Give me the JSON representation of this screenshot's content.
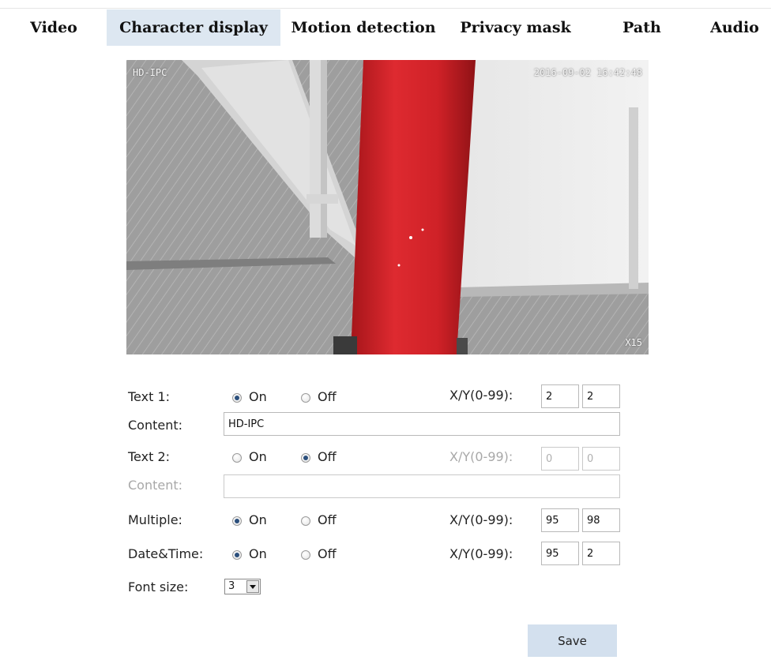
{
  "tabs": {
    "video": "Video",
    "character_display": "Character display",
    "motion_detection": "Motion detection",
    "privacy_mask": "Privacy mask",
    "path": "Path",
    "audio": "Audio"
  },
  "preview": {
    "osd_text1": "HD-IPC",
    "osd_datetime": "2016-09-02 16:42:48",
    "osd_multiple": "X15"
  },
  "form": {
    "text1_label": "Text 1:",
    "text2_label": "Text 2:",
    "content_label": "Content:",
    "multiple_label": "Multiple:",
    "datetime_label": "Date&Time:",
    "font_size_label": "Font size:",
    "on_label": "On",
    "off_label": "Off",
    "xy_label": "X/Y(0-99):",
    "text1": {
      "state": "On",
      "content": "HD-IPC",
      "x": "2",
      "y": "2"
    },
    "text2": {
      "state": "Off",
      "content": "",
      "x": "0",
      "y": "0"
    },
    "multiple": {
      "state": "On",
      "x": "95",
      "y": "98"
    },
    "datetime": {
      "state": "On",
      "x": "95",
      "y": "2"
    },
    "font_size": "3",
    "save_label": "Save"
  },
  "colors": {
    "active_tab": "#dde7f1",
    "save_button": "#d3e0ee",
    "pillar_red": "#d8262c"
  }
}
